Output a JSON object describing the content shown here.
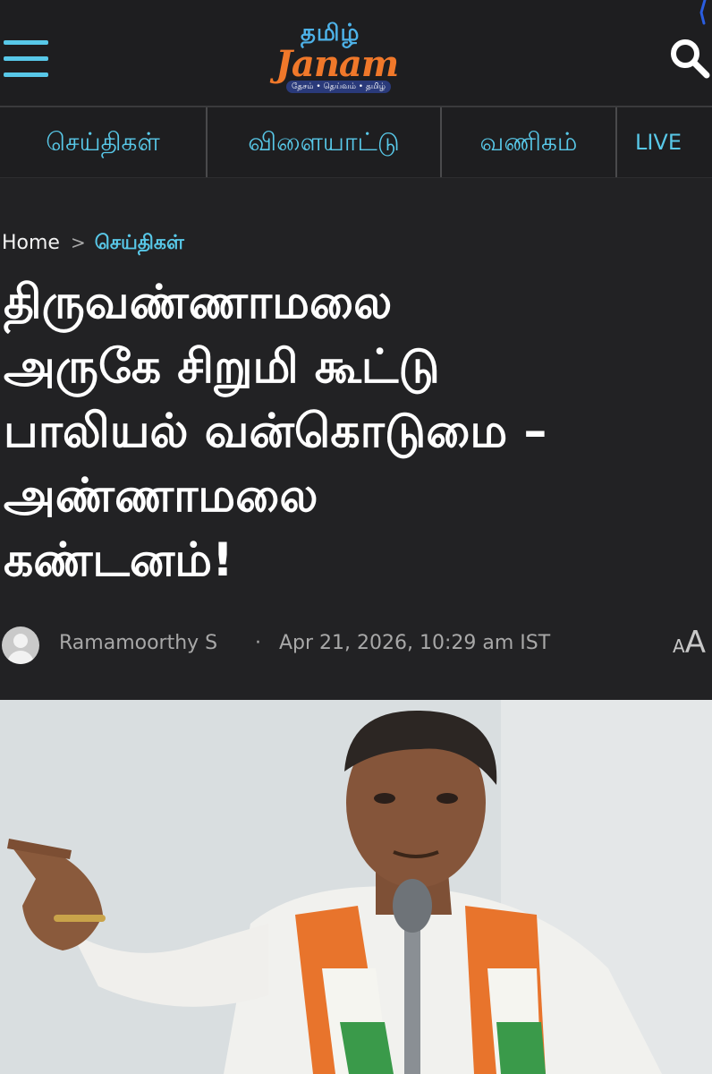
{
  "header": {
    "logo_tamil": "தமிழ்",
    "logo_en": "Janam",
    "logo_tagline": "தேசம் • தெய்வம் • தமிழ்"
  },
  "nav": {
    "items": [
      {
        "label": "செய்திகள்"
      },
      {
        "label": "விளையாட்டு"
      },
      {
        "label": "வணிகம்"
      },
      {
        "label": "LIVE"
      }
    ]
  },
  "breadcrumb": {
    "home": "Home",
    "separator": ">",
    "category": "செய்திகள்"
  },
  "article": {
    "title_lines": [
      "திருவண்ணாமலை",
      "அருகே சிறுமி கூட்டு",
      "பாலியல் வன்கொடுமை –",
      "அண்ணாமலை",
      "கண்டனம்!"
    ],
    "author": "Ramamoorthy S",
    "separator": "·",
    "date": "Apr 21, 2026, 10:29 am IST",
    "font_toggle_small": "A",
    "font_toggle_large": "A"
  },
  "colors": {
    "background": "#222224",
    "accent": "#58c8e8",
    "logo_orange": "#f0782a",
    "meta_text": "#a8a8a8"
  },
  "icons": {
    "menu": "hamburger-icon",
    "search": "search-icon",
    "breadcrumb_chevron": "chevron-right-icon",
    "avatar": "user-avatar-icon"
  }
}
